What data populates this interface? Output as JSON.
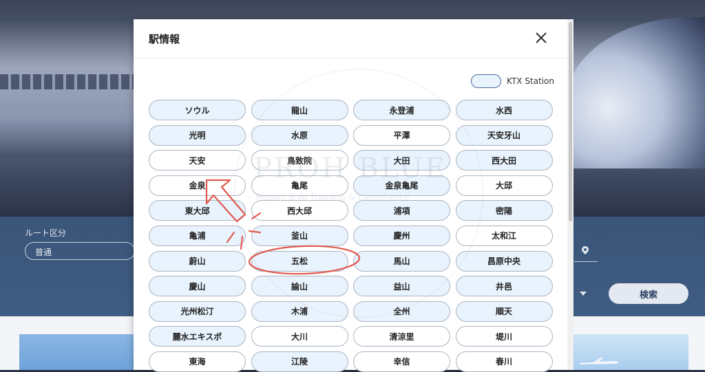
{
  "background": {
    "route_label": "ルート区分",
    "route_value": "普通",
    "search_button": "検索"
  },
  "modal": {
    "title": "駅情報",
    "legend_label": "KTX Station",
    "stations": [
      {
        "name": "ソウル",
        "ktx": true
      },
      {
        "name": "龍山",
        "ktx": true
      },
      {
        "name": "永登浦",
        "ktx": true
      },
      {
        "name": "水西",
        "ktx": true
      },
      {
        "name": "光明",
        "ktx": true
      },
      {
        "name": "水原",
        "ktx": true
      },
      {
        "name": "平澤",
        "ktx": false
      },
      {
        "name": "天安牙山",
        "ktx": true
      },
      {
        "name": "天安",
        "ktx": false
      },
      {
        "name": "鳥致院",
        "ktx": false
      },
      {
        "name": "大田",
        "ktx": true
      },
      {
        "name": "西大田",
        "ktx": true
      },
      {
        "name": "金泉",
        "ktx": false
      },
      {
        "name": "亀尾",
        "ktx": false
      },
      {
        "name": "金泉亀尾",
        "ktx": true
      },
      {
        "name": "大邱",
        "ktx": false
      },
      {
        "name": "東大邱",
        "ktx": true
      },
      {
        "name": "西大邱",
        "ktx": false
      },
      {
        "name": "浦項",
        "ktx": true
      },
      {
        "name": "密陽",
        "ktx": true
      },
      {
        "name": "亀浦",
        "ktx": true
      },
      {
        "name": "釜山",
        "ktx": true
      },
      {
        "name": "慶州",
        "ktx": true
      },
      {
        "name": "太和江",
        "ktx": false
      },
      {
        "name": "蔚山",
        "ktx": true
      },
      {
        "name": "五松",
        "ktx": true
      },
      {
        "name": "馬山",
        "ktx": true
      },
      {
        "name": "昌原中央",
        "ktx": true
      },
      {
        "name": "慶山",
        "ktx": true
      },
      {
        "name": "論山",
        "ktx": true
      },
      {
        "name": "益山",
        "ktx": true
      },
      {
        "name": "井邑",
        "ktx": true
      },
      {
        "name": "光州松汀",
        "ktx": true
      },
      {
        "name": "木浦",
        "ktx": true
      },
      {
        "name": "全州",
        "ktx": true
      },
      {
        "name": "順天",
        "ktx": true
      },
      {
        "name": "麗水エキスポ",
        "ktx": true
      },
      {
        "name": "大川",
        "ktx": false
      },
      {
        "name": "清涼里",
        "ktx": false
      },
      {
        "name": "堤川",
        "ktx": false
      },
      {
        "name": "東海",
        "ktx": false
      },
      {
        "name": "江陵",
        "ktx": true
      },
      {
        "name": "幸信",
        "ktx": false
      },
      {
        "name": "春川",
        "ktx": false
      }
    ]
  },
  "watermark": {
    "text": "PROH BLUE",
    "subtext": "Report & AI Training & compliance"
  },
  "colors": {
    "ktx_fill": "#e8f3fd",
    "annotation_red": "#e0594f"
  }
}
